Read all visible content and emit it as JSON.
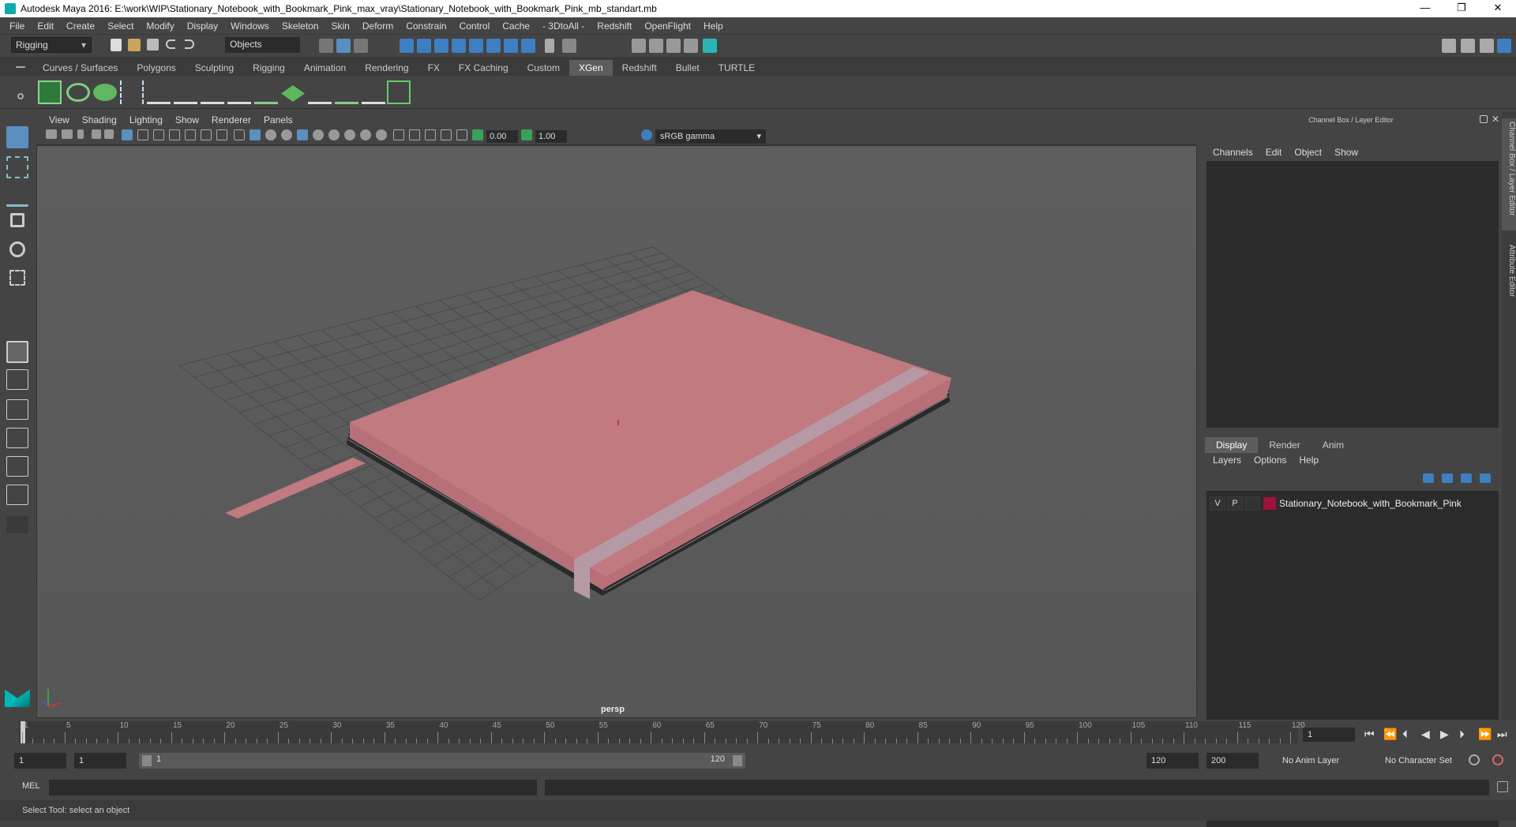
{
  "titlebar": {
    "title": "Autodesk Maya 2016: E:\\work\\WIP\\Stationary_Notebook_with_Bookmark_Pink_max_vray\\Stationary_Notebook_with_Bookmark_Pink_mb_standart.mb",
    "minimize": "—",
    "maximize": "❐",
    "close": "✕"
  },
  "menubar": [
    "File",
    "Edit",
    "Create",
    "Select",
    "Modify",
    "Display",
    "Windows",
    "Skeleton",
    "Skin",
    "Deform",
    "Constrain",
    "Control",
    "Cache",
    "- 3DtoAll -",
    "Redshift",
    "OpenFlight",
    "Help"
  ],
  "status": {
    "mode": "Rigging",
    "selection_mask": "Objects"
  },
  "shelf_tabs": [
    "Curves / Surfaces",
    "Polygons",
    "Sculpting",
    "Rigging",
    "Animation",
    "Rendering",
    "FX",
    "FX Caching",
    "Custom",
    "XGen",
    "Redshift",
    "Bullet",
    "TURTLE"
  ],
  "shelf_active": "XGen",
  "viewport": {
    "menu": [
      "View",
      "Shading",
      "Lighting",
      "Show",
      "Renderer",
      "Panels"
    ],
    "exposure": "0.00",
    "gamma_value": "1.00",
    "color_space": "sRGB gamma",
    "camera": "persp"
  },
  "right_panel": {
    "header": "Channel Box / Layer Editor",
    "channel_menu": [
      "Channels",
      "Edit",
      "Object",
      "Show"
    ],
    "tabs": [
      "Display",
      "Render",
      "Anim"
    ],
    "active_tab": "Display",
    "layer_menu": [
      "Layers",
      "Options",
      "Help"
    ],
    "layer": {
      "v": "V",
      "p": "P",
      "name": "Stationary_Notebook_with_Bookmark_Pink",
      "color": "#a0123a"
    },
    "side_tabs": [
      "Channel Box / Layer Editor",
      "Attribute Editor"
    ]
  },
  "timeline": {
    "labels": [
      "1",
      "5",
      "10",
      "15",
      "20",
      "25",
      "30",
      "35",
      "40",
      "45",
      "50",
      "55",
      "60",
      "65",
      "70",
      "75",
      "80",
      "85",
      "90",
      "95",
      "100",
      "105",
      "110",
      "115",
      "120"
    ],
    "current_frame": "1"
  },
  "range": {
    "start": "1",
    "playback_start": "1",
    "slider_start": "1",
    "slider_end": "120",
    "playback_end": "120",
    "end": "200",
    "anim_layer": "No Anim Layer",
    "char_set": "No Character Set"
  },
  "cmdline": {
    "label": "MEL"
  },
  "helpline": "Select Tool: select an object",
  "colors": {
    "notebook": "#c07a80",
    "band": "#b59aa6",
    "accent": "#00b5b5"
  }
}
